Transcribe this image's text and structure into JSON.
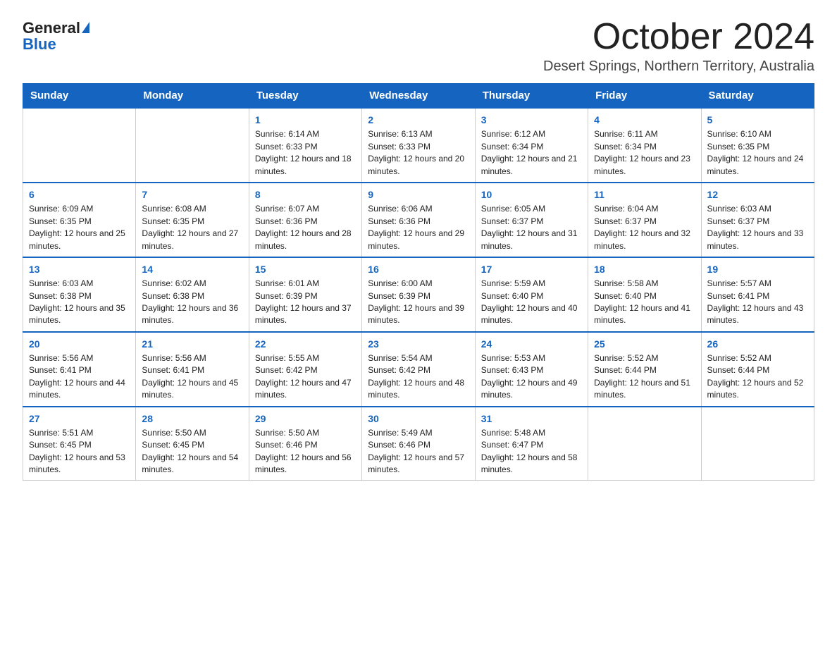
{
  "logo": {
    "general": "General",
    "blue": "Blue"
  },
  "header": {
    "month_title": "October 2024",
    "location": "Desert Springs, Northern Territory, Australia"
  },
  "weekdays": [
    "Sunday",
    "Monday",
    "Tuesday",
    "Wednesday",
    "Thursday",
    "Friday",
    "Saturday"
  ],
  "weeks": [
    [
      {
        "day": "",
        "info": ""
      },
      {
        "day": "",
        "info": ""
      },
      {
        "day": "1",
        "info": "Sunrise: 6:14 AM\nSunset: 6:33 PM\nDaylight: 12 hours and 18 minutes."
      },
      {
        "day": "2",
        "info": "Sunrise: 6:13 AM\nSunset: 6:33 PM\nDaylight: 12 hours and 20 minutes."
      },
      {
        "day": "3",
        "info": "Sunrise: 6:12 AM\nSunset: 6:34 PM\nDaylight: 12 hours and 21 minutes."
      },
      {
        "day": "4",
        "info": "Sunrise: 6:11 AM\nSunset: 6:34 PM\nDaylight: 12 hours and 23 minutes."
      },
      {
        "day": "5",
        "info": "Sunrise: 6:10 AM\nSunset: 6:35 PM\nDaylight: 12 hours and 24 minutes."
      }
    ],
    [
      {
        "day": "6",
        "info": "Sunrise: 6:09 AM\nSunset: 6:35 PM\nDaylight: 12 hours and 25 minutes."
      },
      {
        "day": "7",
        "info": "Sunrise: 6:08 AM\nSunset: 6:35 PM\nDaylight: 12 hours and 27 minutes."
      },
      {
        "day": "8",
        "info": "Sunrise: 6:07 AM\nSunset: 6:36 PM\nDaylight: 12 hours and 28 minutes."
      },
      {
        "day": "9",
        "info": "Sunrise: 6:06 AM\nSunset: 6:36 PM\nDaylight: 12 hours and 29 minutes."
      },
      {
        "day": "10",
        "info": "Sunrise: 6:05 AM\nSunset: 6:37 PM\nDaylight: 12 hours and 31 minutes."
      },
      {
        "day": "11",
        "info": "Sunrise: 6:04 AM\nSunset: 6:37 PM\nDaylight: 12 hours and 32 minutes."
      },
      {
        "day": "12",
        "info": "Sunrise: 6:03 AM\nSunset: 6:37 PM\nDaylight: 12 hours and 33 minutes."
      }
    ],
    [
      {
        "day": "13",
        "info": "Sunrise: 6:03 AM\nSunset: 6:38 PM\nDaylight: 12 hours and 35 minutes."
      },
      {
        "day": "14",
        "info": "Sunrise: 6:02 AM\nSunset: 6:38 PM\nDaylight: 12 hours and 36 minutes."
      },
      {
        "day": "15",
        "info": "Sunrise: 6:01 AM\nSunset: 6:39 PM\nDaylight: 12 hours and 37 minutes."
      },
      {
        "day": "16",
        "info": "Sunrise: 6:00 AM\nSunset: 6:39 PM\nDaylight: 12 hours and 39 minutes."
      },
      {
        "day": "17",
        "info": "Sunrise: 5:59 AM\nSunset: 6:40 PM\nDaylight: 12 hours and 40 minutes."
      },
      {
        "day": "18",
        "info": "Sunrise: 5:58 AM\nSunset: 6:40 PM\nDaylight: 12 hours and 41 minutes."
      },
      {
        "day": "19",
        "info": "Sunrise: 5:57 AM\nSunset: 6:41 PM\nDaylight: 12 hours and 43 minutes."
      }
    ],
    [
      {
        "day": "20",
        "info": "Sunrise: 5:56 AM\nSunset: 6:41 PM\nDaylight: 12 hours and 44 minutes."
      },
      {
        "day": "21",
        "info": "Sunrise: 5:56 AM\nSunset: 6:41 PM\nDaylight: 12 hours and 45 minutes."
      },
      {
        "day": "22",
        "info": "Sunrise: 5:55 AM\nSunset: 6:42 PM\nDaylight: 12 hours and 47 minutes."
      },
      {
        "day": "23",
        "info": "Sunrise: 5:54 AM\nSunset: 6:42 PM\nDaylight: 12 hours and 48 minutes."
      },
      {
        "day": "24",
        "info": "Sunrise: 5:53 AM\nSunset: 6:43 PM\nDaylight: 12 hours and 49 minutes."
      },
      {
        "day": "25",
        "info": "Sunrise: 5:52 AM\nSunset: 6:44 PM\nDaylight: 12 hours and 51 minutes."
      },
      {
        "day": "26",
        "info": "Sunrise: 5:52 AM\nSunset: 6:44 PM\nDaylight: 12 hours and 52 minutes."
      }
    ],
    [
      {
        "day": "27",
        "info": "Sunrise: 5:51 AM\nSunset: 6:45 PM\nDaylight: 12 hours and 53 minutes."
      },
      {
        "day": "28",
        "info": "Sunrise: 5:50 AM\nSunset: 6:45 PM\nDaylight: 12 hours and 54 minutes."
      },
      {
        "day": "29",
        "info": "Sunrise: 5:50 AM\nSunset: 6:46 PM\nDaylight: 12 hours and 56 minutes."
      },
      {
        "day": "30",
        "info": "Sunrise: 5:49 AM\nSunset: 6:46 PM\nDaylight: 12 hours and 57 minutes."
      },
      {
        "day": "31",
        "info": "Sunrise: 5:48 AM\nSunset: 6:47 PM\nDaylight: 12 hours and 58 minutes."
      },
      {
        "day": "",
        "info": ""
      },
      {
        "day": "",
        "info": ""
      }
    ]
  ]
}
